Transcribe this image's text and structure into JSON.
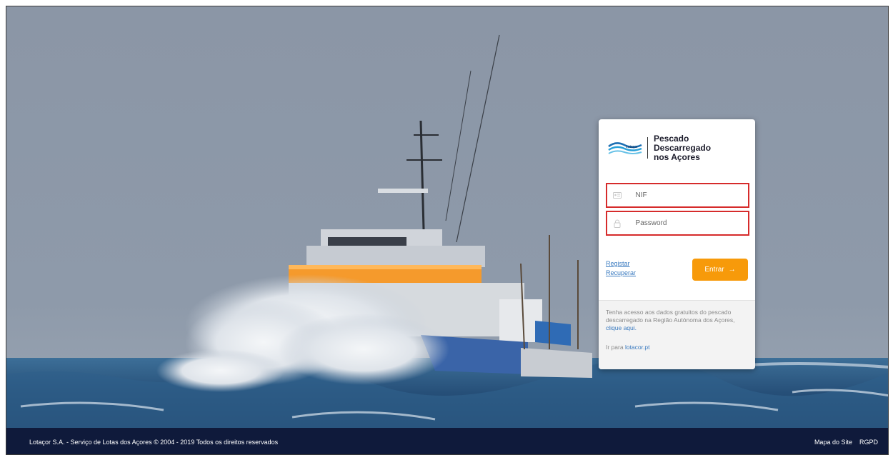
{
  "login": {
    "title_line1": "Pescado Descarregado",
    "title_line2": "nos Açores",
    "nif_placeholder": "NIF",
    "password_placeholder": "Password",
    "register_link": "Registar",
    "recover_link": "Recuperar",
    "enter_button": "Entrar",
    "enter_arrow": "→",
    "info_text": "Tenha acesso aos dados gratuitos do pescado descarregado na Região Autónoma dos Açores,",
    "info_link": "clique aqui.",
    "goto_prefix": "Ir para",
    "goto_link": "lotacor.pt"
  },
  "logo_text": "Lotaçor",
  "footer": {
    "copyright": "Lotaçor S.A. - Serviço de Lotas dos Açores © 2004 - 2019 Todos os direitos reservados",
    "sitemap": "Mapa do Site",
    "rgpd": "RGPD"
  },
  "icons": {
    "nif": "id-card-icon",
    "password": "lock-icon",
    "enter": "arrow-right-icon"
  },
  "colors": {
    "accent": "#f79a0a",
    "footer_bg": "#0f1a3b",
    "field_highlight": "#d62b2b",
    "link": "#3b7bc0"
  }
}
